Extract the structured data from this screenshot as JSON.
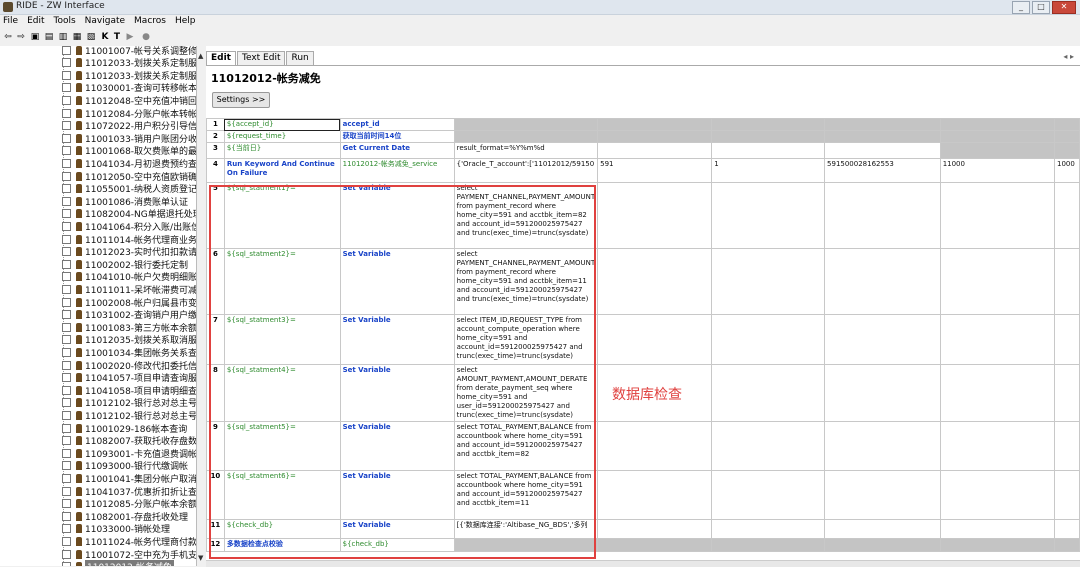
{
  "window": {
    "title": "RIDE - ZW Interface",
    "min": "_",
    "max": "□",
    "close": "✕"
  },
  "menu": [
    "File",
    "Edit",
    "Tools",
    "Navigate",
    "Macros",
    "Help"
  ],
  "toolbar": {
    "items": [
      "⇦",
      "⇨",
      "▣",
      "▤",
      "▥",
      "▦",
      "▧",
      "K",
      "T",
      "▶",
      "●"
    ]
  },
  "tree": {
    "items": [
      "11001007-帐号关系调整修改",
      "11012033-划拨关系定制服务",
      "11012033-划拨关系定制服务",
      "11030001-查询可转移帐本信息",
      "11012048-空中充值冲销回退",
      "11012084-分账户帐本转帐",
      "11072022-用户积分引导信息",
      "11001033-销用户账团分收",
      "11001068-取欠费账单的最多",
      "11041034-月初退费预约查询",
      "11012050-空中充值欧销确认",
      "11055001-纳税人资质登记服",
      "11001086-消费账单认证",
      "11082004-NG单据退托处理",
      "11041064-积分入账/出账信息",
      "11011014-帐务代理商业务受",
      "11012023-实时代扣扣款请求",
      "11002002-银行委托定制",
      "11041010-帐户欠费明细账单",
      "11011011-呆坏帐滞费可减免",
      "11002008-帐户归属县市变更",
      "11031002-查询销户用户缴费",
      "11001083-第三方帐本余额查",
      "11012035-划拨关系取消服务",
      "11001034-集团帐务关系查询",
      "11002020-修改代扣委托信息",
      "11041057-项目申请查询服务",
      "11041058-项目申请明细查询",
      "11012102-银行总对总主号用",
      "11012102-银行总对总主号用",
      "11001029-186帐本查询",
      "11082007-获取托收存盘数据",
      "11093001-卡充值退费调帐",
      "11093000-银行代缴调帐",
      "11001041-集团分帐户取消",
      "11041037-优惠折扣折让查询",
      "11012085-分账户帐本余额转",
      "11082001-存盘托收处理",
      "11033000-销帐处理",
      "11011024-帐务代理商付款业",
      "11001072-空中充为手机支付",
      "11012012-帐务减免"
    ],
    "selected_index": 41
  },
  "editor": {
    "tabs": [
      "Edit",
      "Text Edit",
      "Run"
    ],
    "active_tab": "Edit",
    "title": "11012012-帐务减免",
    "settings_button": "Settings >>",
    "annotation": "数据库检查",
    "rows": [
      {
        "num": "1",
        "c1": "${accept_id}",
        "c2": "accept_id",
        "c3": "",
        "c4": "",
        "c5": "",
        "c6": "",
        "c7": "",
        "c8": ""
      },
      {
        "num": "2",
        "c1": "${request_time}",
        "c2": "获取当前时间14位",
        "c3": "",
        "c4": "",
        "c5": "",
        "c6": "",
        "c7": "",
        "c8": ""
      },
      {
        "num": "3",
        "c1": "${当前日}",
        "c2": "Get Current Date",
        "c3": "result_format=%Y%m%d",
        "c4": "",
        "c5": "",
        "c6": "",
        "c7": "",
        "c8": ""
      },
      {
        "num": "4",
        "c1": "Run Keyword And Continue On Failure",
        "c2": "11012012-帐务减免_service",
        "c3": "{'Oracle_T_account':['11012012/59150",
        "c4": "591",
        "c5": "1",
        "c6": "591500028162553",
        "c7": "11000",
        "c8": "1000"
      },
      {
        "num": "5",
        "c1": "${sql_statment1}=",
        "c2": "Set Variable",
        "c3": "select PAYMENT_CHANNEL,PAYMENT_AMOUNT from payment_record where home_city=591 and acctbk_item=82 and account_id=591200025975427 and trunc(exec_time)=trunc(sysdate)",
        "c4": "",
        "c5": "",
        "c6": "",
        "c7": "",
        "c8": ""
      },
      {
        "num": "6",
        "c1": "${sql_statment2}=",
        "c2": "Set Variable",
        "c3": "select PAYMENT_CHANNEL,PAYMENT_AMOUNT from payment_record where home_city=591 and acctbk_item=11 and account_id=591200025975427 and trunc(exec_time)=trunc(sysdate)",
        "c4": "",
        "c5": "",
        "c6": "",
        "c7": "",
        "c8": ""
      },
      {
        "num": "7",
        "c1": "${sql_statment3}=",
        "c2": "Set Variable",
        "c3": "select ITEM_ID,REQUEST_TYPE from account_compute_operation where home_city=591 and account_id=591200025975427 and trunc(exec_time)=trunc(sysdate)",
        "c4": "",
        "c5": "",
        "c6": "",
        "c7": "",
        "c8": ""
      },
      {
        "num": "8",
        "c1": "${sql_statment4}=",
        "c2": "Set Variable",
        "c3": "select AMOUNT_PAYMENT,AMOUNT_DERATE from derate_payment_seq where home_city=591 and user_id=591200025975427 and trunc(exec_time)=trunc(sysdate)",
        "c4": "",
        "c5": "",
        "c6": "",
        "c7": "",
        "c8": ""
      },
      {
        "num": "9",
        "c1": "${sql_statment5}=",
        "c2": "Set Variable",
        "c3": "select TOTAL_PAYMENT,BALANCE from accountbook where home_city=591 and account_id=591200025975427 and acctbk_item=82",
        "c4": "",
        "c5": "",
        "c6": "",
        "c7": "",
        "c8": ""
      },
      {
        "num": "10",
        "c1": "${sql_statment6}=",
        "c2": "Set Variable",
        "c3": "select TOTAL_PAYMENT,BALANCE from accountbook where home_city=591 and account_id=591200025975427 and acctbk_item=11",
        "c4": "",
        "c5": "",
        "c6": "",
        "c7": "",
        "c8": ""
      },
      {
        "num": "11",
        "c1": "${check_db}",
        "c2": "Set Variable",
        "c3": "[{'数据库连接':'Altibase_NG_BDS','多列",
        "c4": "",
        "c5": "",
        "c6": "",
        "c7": "",
        "c8": ""
      },
      {
        "num": "12",
        "c1": "多数据检查点校验",
        "c2": "${check_db}",
        "c3": "",
        "c4": "",
        "c5": "",
        "c6": "",
        "c7": "",
        "c8": ""
      }
    ]
  },
  "colors": {
    "green": "#2e8b2e",
    "blue": "#1a44c8",
    "red": "#e0413f",
    "gray_cell": "#c4c4c4"
  }
}
